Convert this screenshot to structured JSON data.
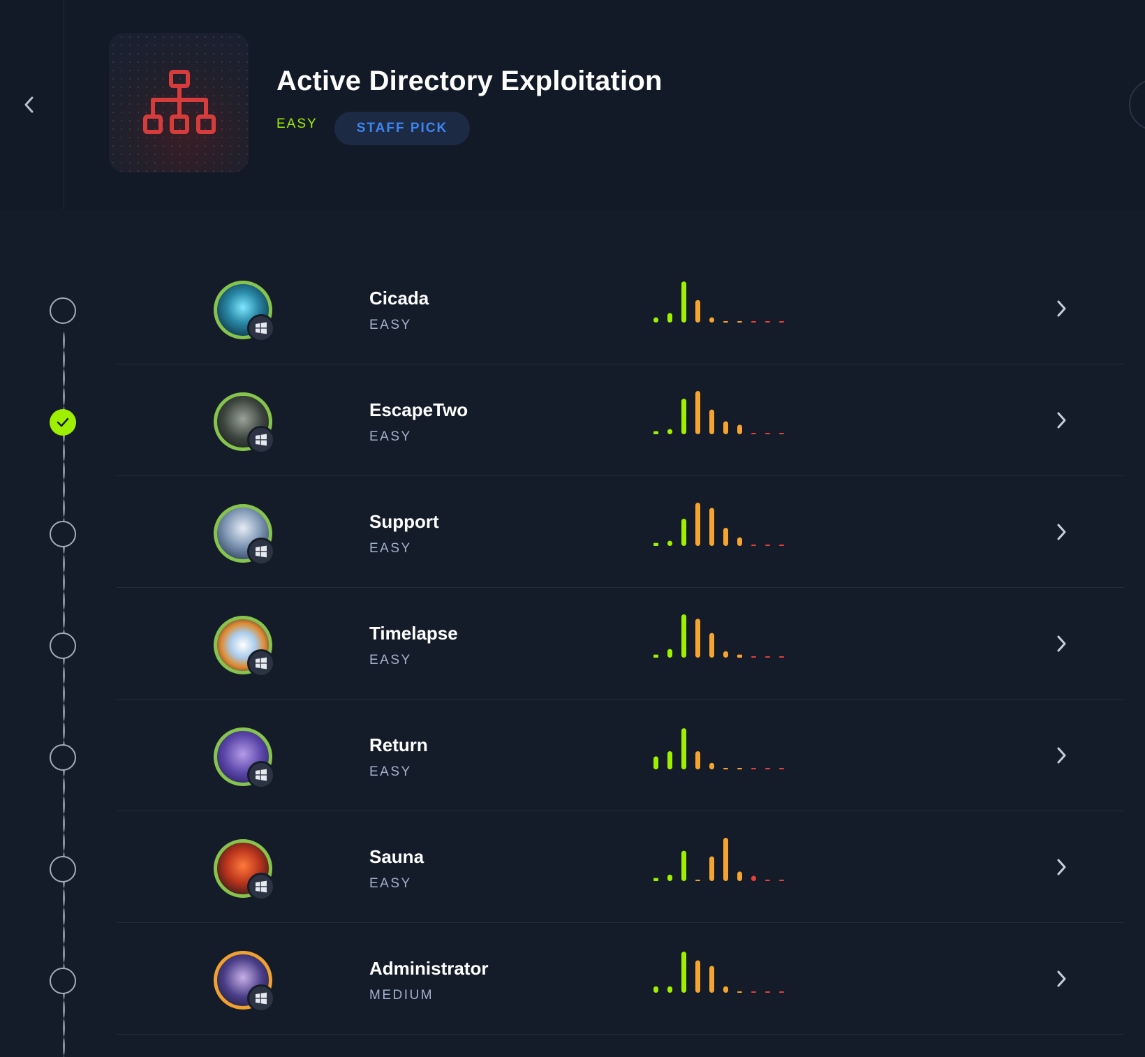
{
  "header": {
    "title": "Active Directory Exploitation",
    "difficulty": "EASY",
    "badge": "STAFF PICK"
  },
  "colors": {
    "background": "#151c29",
    "easy_green": "#9fef00",
    "rating_orange": "#f5a331",
    "rating_red": "#e2413c",
    "staff_pick_blue": "#3d86f2",
    "logo_red": "#d63c3c"
  },
  "machines": [
    {
      "name": "Cicada",
      "difficulty": "EASY",
      "completed": false,
      "os_icon": "windows-icon",
      "avatar_icon": "cicada-avatar-icon",
      "rating": [
        0.12,
        0.22,
        0.95,
        0.52,
        0.12,
        0.02,
        0.02,
        0.02,
        0.02,
        0.02
      ]
    },
    {
      "name": "EscapeTwo",
      "difficulty": "EASY",
      "completed": true,
      "os_icon": "windows-icon",
      "avatar_icon": "escapetwo-avatar-icon",
      "rating": [
        0.07,
        0.12,
        0.82,
        1.0,
        0.57,
        0.3,
        0.22,
        0.02,
        0.02,
        0.02
      ]
    },
    {
      "name": "Support",
      "difficulty": "EASY",
      "completed": false,
      "os_icon": "windows-icon",
      "avatar_icon": "support-avatar-icon",
      "rating": [
        0.07,
        0.12,
        0.63,
        1.0,
        0.88,
        0.42,
        0.2,
        0.02,
        0.02,
        0.02
      ]
    },
    {
      "name": "Timelapse",
      "difficulty": "EASY",
      "completed": false,
      "os_icon": "windows-icon",
      "avatar_icon": "timelapse-avatar-icon",
      "rating": [
        0.07,
        0.2,
        1.0,
        0.9,
        0.57,
        0.15,
        0.07,
        0.02,
        0.02,
        0.02
      ]
    },
    {
      "name": "Return",
      "difficulty": "EASY",
      "completed": false,
      "os_icon": "windows-icon",
      "avatar_icon": "return-avatar-icon",
      "rating": [
        0.3,
        0.42,
        0.95,
        0.42,
        0.15,
        0.02,
        0.02,
        0.02,
        0.02,
        0.02
      ]
    },
    {
      "name": "Sauna",
      "difficulty": "EASY",
      "completed": false,
      "os_icon": "windows-icon",
      "avatar_icon": "sauna-avatar-icon",
      "rating": [
        0.07,
        0.15,
        0.7,
        0.02,
        0.57,
        1.0,
        0.22,
        0.12,
        0.02,
        0.02
      ]
    },
    {
      "name": "Administrator",
      "difficulty": "MEDIUM",
      "completed": false,
      "os_icon": "windows-icon",
      "avatar_icon": "administrator-avatar-icon",
      "rating": [
        0.15,
        0.15,
        0.95,
        0.75,
        0.62,
        0.15,
        0.02,
        0.02,
        0.02,
        0.02
      ]
    }
  ]
}
